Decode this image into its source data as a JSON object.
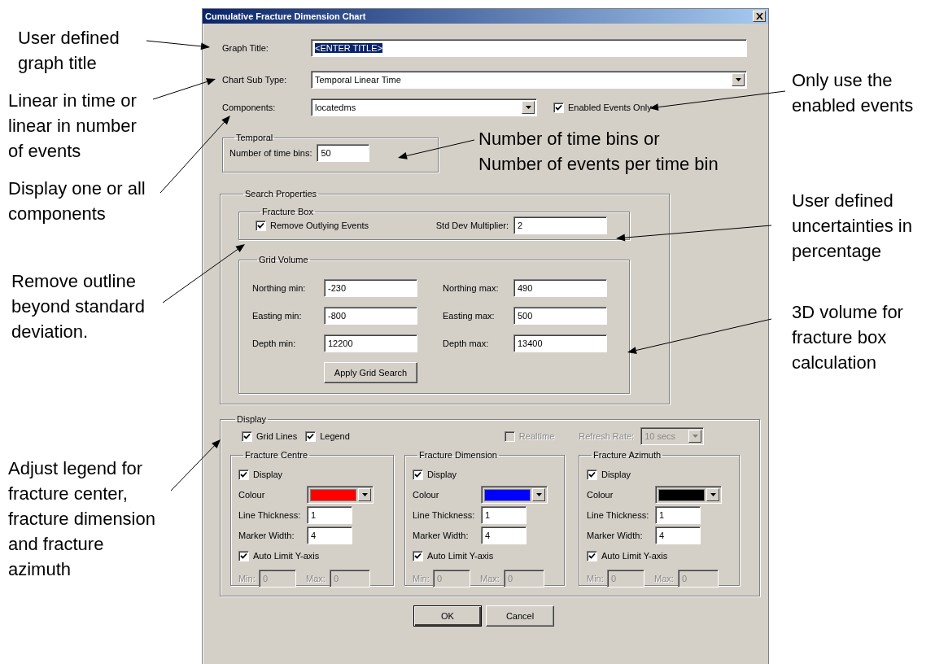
{
  "annotations": [
    {
      "lines": [
        "User defined",
        "graph title"
      ]
    },
    {
      "lines": [
        "Only use the",
        "enabled events"
      ]
    },
    {
      "lines": [
        "Linear in time or",
        "linear in number",
        "of events"
      ]
    },
    {
      "lines": [
        "Number of time bins or",
        "Number of events per time bin"
      ]
    },
    {
      "lines": [
        "Display one or all",
        "components"
      ]
    },
    {
      "lines": [
        "User defined",
        "uncertainties in",
        "percentage"
      ]
    },
    {
      "lines": [
        "Remove outline",
        "beyond standard",
        "deviation."
      ]
    },
    {
      "lines": [
        "3D volume for",
        "fracture box",
        "calculation"
      ]
    },
    {
      "lines": [
        "Adjust legend for",
        "fracture center,",
        "fracture dimension",
        "and fracture",
        "azimuth"
      ]
    }
  ],
  "dialog": {
    "title": "Cumulative Fracture Dimension Chart",
    "graph_title": {
      "label": "Graph Title:",
      "value": "<ENTER TITLE>",
      "highlighted": true
    },
    "chart_sub_type": {
      "label": "Chart Sub Type:",
      "value": "Temporal Linear Time"
    },
    "components": {
      "label": "Components:",
      "value": "locatedms"
    },
    "enabled_events_only": {
      "label": "Enabled Events Only",
      "checked": true
    },
    "temporal": {
      "title": "Temporal",
      "label": "Number of time bins:",
      "value": "50"
    },
    "search_properties": {
      "title": "Search Properties",
      "fracture_box": {
        "title": "Fracture Box",
        "remove_outlying": {
          "label": "Remove Outlying Events",
          "checked": true
        },
        "std_dev": {
          "label": "Std Dev Multiplier:",
          "value": "2"
        }
      },
      "grid_volume": {
        "title": "Grid Volume",
        "fields": [
          {
            "label": "Northing min:",
            "value": "-230"
          },
          {
            "label": "Northing max:",
            "value": "490"
          },
          {
            "label": "Easting min:",
            "value": "-800"
          },
          {
            "label": "Easting max:",
            "value": "500"
          },
          {
            "label": "Depth min:",
            "value": "12200"
          },
          {
            "label": "Depth max:",
            "value": "13400"
          }
        ],
        "button": "Apply Grid Search"
      }
    },
    "display": {
      "title": "Display",
      "options": [
        {
          "label": "Grid Lines",
          "checked": true,
          "disabled": false
        },
        {
          "label": "Legend",
          "checked": true,
          "disabled": false
        },
        {
          "label": "Realtime",
          "checked": false,
          "disabled": true
        }
      ],
      "refresh_rate": {
        "label": "Refresh Rate:",
        "value": "10 secs",
        "disabled": true
      },
      "series": [
        {
          "title": "Fracture Centre",
          "display": {
            "label": "Display",
            "checked": true
          },
          "colour_label": "Colour",
          "color": "#ff0000",
          "line_thickness": {
            "label": "Line Thickness:",
            "value": "1"
          },
          "marker_width": {
            "label": "Marker Width:",
            "value": "4"
          },
          "auto_limit": {
            "label": "Auto Limit Y-axis",
            "checked": true
          },
          "min": {
            "label": "Min:",
            "value": "0"
          },
          "max": {
            "label": "Max:",
            "value": "0"
          }
        },
        {
          "title": "Fracture Dimension",
          "display": {
            "label": "Display",
            "checked": true
          },
          "colour_label": "Colour",
          "color": "#0000ff",
          "line_thickness": {
            "label": "Line Thickness:",
            "value": "1"
          },
          "marker_width": {
            "label": "Marker Width:",
            "value": "4"
          },
          "auto_limit": {
            "label": "Auto Limit Y-axis",
            "checked": true
          },
          "min": {
            "label": "Min:",
            "value": "0"
          },
          "max": {
            "label": "Max:",
            "value": "0"
          }
        },
        {
          "title": "Fracture Azimuth",
          "display": {
            "label": "Display",
            "checked": true
          },
          "colour_label": "Colour",
          "color": "#000000",
          "line_thickness": {
            "label": "Line Thickness:",
            "value": "1"
          },
          "marker_width": {
            "label": "Marker Width:",
            "value": "4"
          },
          "auto_limit": {
            "label": "Auto Limit Y-axis",
            "checked": true
          },
          "min": {
            "label": "Min:",
            "value": "0"
          },
          "max": {
            "label": "Max:",
            "value": "0"
          }
        }
      ]
    },
    "buttons": [
      {
        "label": "OK",
        "default": true
      },
      {
        "label": "Cancel",
        "default": false
      }
    ]
  }
}
